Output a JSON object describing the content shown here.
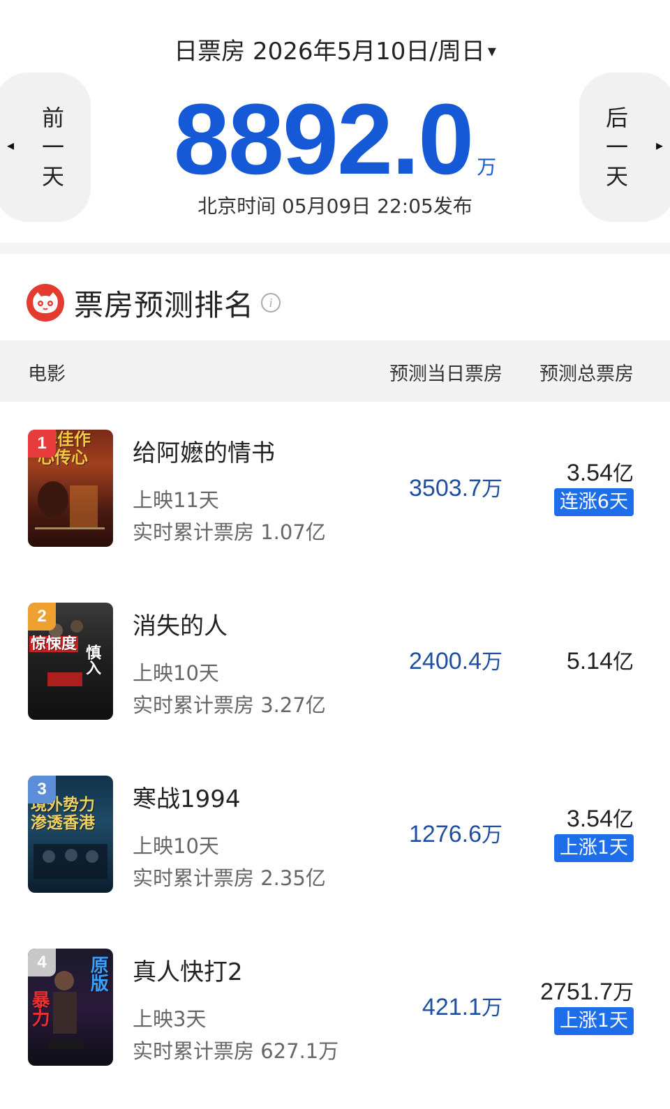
{
  "header": {
    "label": "日票房",
    "date": "2026年5月10日/周日",
    "caret": "▾",
    "prev_label": "前一天",
    "next_label": "后一天",
    "prev_arrow": "◂",
    "next_arrow": "▸",
    "total": "8892.0",
    "total_unit": "万",
    "publish": "北京时间  05月09日  22:05发布"
  },
  "section": {
    "title": "票房预测排名",
    "info": "i",
    "logo_color": "#e53a30"
  },
  "table": {
    "col_movie": "电影",
    "col_day": "预测当日票房",
    "col_total": "预测总票房"
  },
  "movies": [
    {
      "rank": "1",
      "name": "给阿嬷的情书",
      "days": "上映11天",
      "cum": "实时累计票房 1.07亿",
      "day_value": "3503.7",
      "day_unit": "万",
      "total_value": "3.54",
      "total_unit": "亿",
      "tag": "连涨6天",
      "poster_text_1": "碑佳作",
      "poster_text_2": "心传心",
      "badge_color": "#e83c3c"
    },
    {
      "rank": "2",
      "name": "消失的人",
      "days": "上映10天",
      "cum": "实时累计票房 3.27亿",
      "day_value": "2400.4",
      "day_unit": "万",
      "total_value": "5.14",
      "total_unit": "亿",
      "tag": "",
      "poster_text_1": "惊悚度",
      "poster_text_2": "慎入",
      "badge_color": "#f0a030"
    },
    {
      "rank": "3",
      "name": "寒战1994",
      "days": "上映10天",
      "cum": "实时累计票房 2.35亿",
      "day_value": "1276.6",
      "day_unit": "万",
      "total_value": "3.54",
      "total_unit": "亿",
      "tag": "上涨1天",
      "poster_text_1": "境外势力",
      "poster_text_2": "渗透香港",
      "badge_color": "#5b8dd9"
    },
    {
      "rank": "4",
      "name": "真人快打2",
      "days": "上映3天",
      "cum": "实时累计票房 627.1万",
      "day_value": "421.1",
      "day_unit": "万",
      "total_value": "2751.7",
      "total_unit": "万",
      "tag": "上涨1天",
      "poster_text_1": "原版",
      "poster_text_2": "暴力",
      "badge_color": "#c8c8c8"
    }
  ]
}
